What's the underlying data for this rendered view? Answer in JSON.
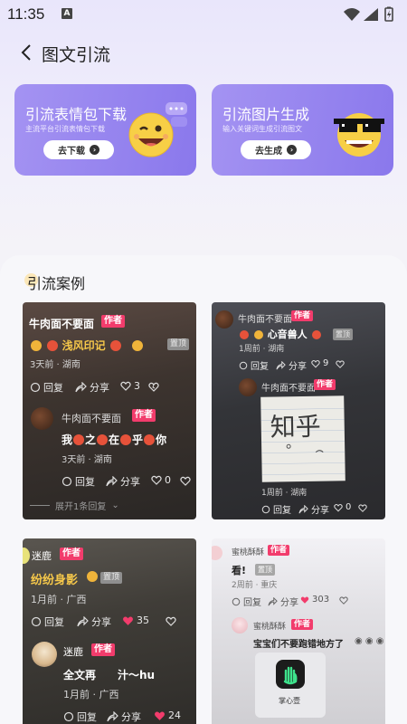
{
  "status": {
    "time": "11:35",
    "indicator": "A"
  },
  "header": {
    "title": "图文引流"
  },
  "promos": [
    {
      "title": "引流表情包下载",
      "subtitle": "主流平台引流表情包下载",
      "button": "去下载"
    },
    {
      "title": "引流图片生成",
      "subtitle": "输入关键词生成引流图文",
      "button": "去生成"
    }
  ],
  "section": {
    "title": "引流案例"
  },
  "cards": [
    {
      "author": "牛肉面不要面",
      "badge": "作者",
      "content": "浅风印记",
      "pinned": "置顶",
      "meta": "3天前 · 湖南",
      "reply": "回复",
      "share": "分享",
      "likes": "3",
      "sub": {
        "author": "牛肉面不要面",
        "badge": "作者",
        "content_parts": [
          "我",
          "之",
          "在",
          "乎",
          "你"
        ],
        "meta": "3天前 · 湖南",
        "reply": "回复",
        "share": "分享",
        "likes": "0"
      },
      "expand": "展开1条回复"
    },
    {
      "author": "牛肉面不要面",
      "badge": "作者",
      "content": "心音兽人",
      "pinned": "置顶",
      "meta": "1周前 · 湖南",
      "reply": "回复",
      "share": "分享",
      "likes": "9",
      "sub": {
        "author": "牛肉面不要面",
        "badge": "作者",
        "image_text": "知乎",
        "meta": "1周前 · 湖南",
        "reply": "回复",
        "share": "分享",
        "likes": "0"
      }
    },
    {
      "author": "迷鹿",
      "badge": "作者",
      "content": "纷纷身影",
      "pinned": "置顶",
      "meta": "1月前 · 广西",
      "reply": "回复",
      "share": "分享",
      "likes": "35",
      "sub": {
        "author": "迷鹿",
        "badge": "作者",
        "content": "全文再　　汁～hu",
        "meta": "1月前 · 广西",
        "reply": "回复",
        "share": "分享",
        "likes": "24"
      }
    },
    {
      "author": "蜜桃酥酥",
      "badge": "作者",
      "content": "看!",
      "pinned": "置顶",
      "meta": "2周前 · 重庆",
      "reply": "回复",
      "share": "分享",
      "likes": "303",
      "sub": {
        "author": "蜜桃酥酥",
        "badge": "作者",
        "content": "宝宝们不要跑错地方了",
        "app_label": "掌心壹"
      }
    }
  ],
  "colors": {
    "accent": "#9685ef",
    "badge": "#f23c6c",
    "like_red": "#f23c6c",
    "gold_text": "#f6c84a"
  }
}
